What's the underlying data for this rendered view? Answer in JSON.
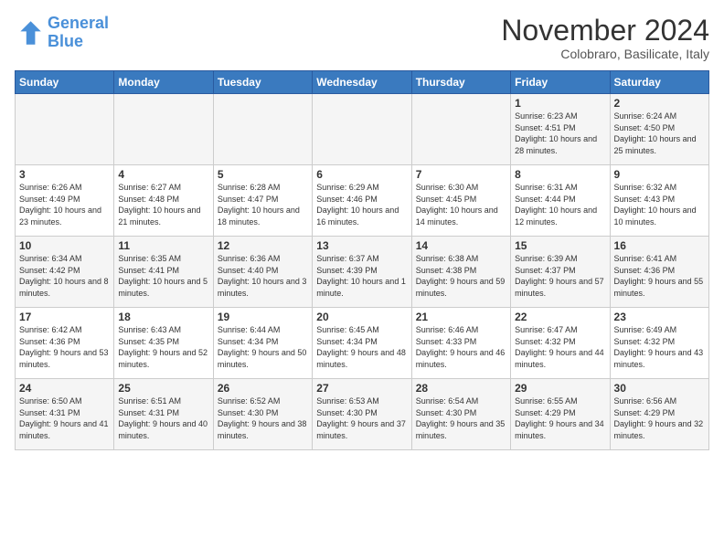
{
  "header": {
    "logo_line1": "General",
    "logo_line2": "Blue",
    "title": "November 2024",
    "subtitle": "Colobraro, Basilicate, Italy"
  },
  "columns": [
    "Sunday",
    "Monday",
    "Tuesday",
    "Wednesday",
    "Thursday",
    "Friday",
    "Saturday"
  ],
  "weeks": [
    [
      {
        "day": "",
        "info": ""
      },
      {
        "day": "",
        "info": ""
      },
      {
        "day": "",
        "info": ""
      },
      {
        "day": "",
        "info": ""
      },
      {
        "day": "",
        "info": ""
      },
      {
        "day": "1",
        "info": "Sunrise: 6:23 AM\nSunset: 4:51 PM\nDaylight: 10 hours\nand 28 minutes."
      },
      {
        "day": "2",
        "info": "Sunrise: 6:24 AM\nSunset: 4:50 PM\nDaylight: 10 hours\nand 25 minutes."
      }
    ],
    [
      {
        "day": "3",
        "info": "Sunrise: 6:26 AM\nSunset: 4:49 PM\nDaylight: 10 hours\nand 23 minutes."
      },
      {
        "day": "4",
        "info": "Sunrise: 6:27 AM\nSunset: 4:48 PM\nDaylight: 10 hours\nand 21 minutes."
      },
      {
        "day": "5",
        "info": "Sunrise: 6:28 AM\nSunset: 4:47 PM\nDaylight: 10 hours\nand 18 minutes."
      },
      {
        "day": "6",
        "info": "Sunrise: 6:29 AM\nSunset: 4:46 PM\nDaylight: 10 hours\nand 16 minutes."
      },
      {
        "day": "7",
        "info": "Sunrise: 6:30 AM\nSunset: 4:45 PM\nDaylight: 10 hours\nand 14 minutes."
      },
      {
        "day": "8",
        "info": "Sunrise: 6:31 AM\nSunset: 4:44 PM\nDaylight: 10 hours\nand 12 minutes."
      },
      {
        "day": "9",
        "info": "Sunrise: 6:32 AM\nSunset: 4:43 PM\nDaylight: 10 hours\nand 10 minutes."
      }
    ],
    [
      {
        "day": "10",
        "info": "Sunrise: 6:34 AM\nSunset: 4:42 PM\nDaylight: 10 hours\nand 8 minutes."
      },
      {
        "day": "11",
        "info": "Sunrise: 6:35 AM\nSunset: 4:41 PM\nDaylight: 10 hours\nand 5 minutes."
      },
      {
        "day": "12",
        "info": "Sunrise: 6:36 AM\nSunset: 4:40 PM\nDaylight: 10 hours\nand 3 minutes."
      },
      {
        "day": "13",
        "info": "Sunrise: 6:37 AM\nSunset: 4:39 PM\nDaylight: 10 hours\nand 1 minute."
      },
      {
        "day": "14",
        "info": "Sunrise: 6:38 AM\nSunset: 4:38 PM\nDaylight: 9 hours\nand 59 minutes."
      },
      {
        "day": "15",
        "info": "Sunrise: 6:39 AM\nSunset: 4:37 PM\nDaylight: 9 hours\nand 57 minutes."
      },
      {
        "day": "16",
        "info": "Sunrise: 6:41 AM\nSunset: 4:36 PM\nDaylight: 9 hours\nand 55 minutes."
      }
    ],
    [
      {
        "day": "17",
        "info": "Sunrise: 6:42 AM\nSunset: 4:36 PM\nDaylight: 9 hours\nand 53 minutes."
      },
      {
        "day": "18",
        "info": "Sunrise: 6:43 AM\nSunset: 4:35 PM\nDaylight: 9 hours\nand 52 minutes."
      },
      {
        "day": "19",
        "info": "Sunrise: 6:44 AM\nSunset: 4:34 PM\nDaylight: 9 hours\nand 50 minutes."
      },
      {
        "day": "20",
        "info": "Sunrise: 6:45 AM\nSunset: 4:34 PM\nDaylight: 9 hours\nand 48 minutes."
      },
      {
        "day": "21",
        "info": "Sunrise: 6:46 AM\nSunset: 4:33 PM\nDaylight: 9 hours\nand 46 minutes."
      },
      {
        "day": "22",
        "info": "Sunrise: 6:47 AM\nSunset: 4:32 PM\nDaylight: 9 hours\nand 44 minutes."
      },
      {
        "day": "23",
        "info": "Sunrise: 6:49 AM\nSunset: 4:32 PM\nDaylight: 9 hours\nand 43 minutes."
      }
    ],
    [
      {
        "day": "24",
        "info": "Sunrise: 6:50 AM\nSunset: 4:31 PM\nDaylight: 9 hours\nand 41 minutes."
      },
      {
        "day": "25",
        "info": "Sunrise: 6:51 AM\nSunset: 4:31 PM\nDaylight: 9 hours\nand 40 minutes."
      },
      {
        "day": "26",
        "info": "Sunrise: 6:52 AM\nSunset: 4:30 PM\nDaylight: 9 hours\nand 38 minutes."
      },
      {
        "day": "27",
        "info": "Sunrise: 6:53 AM\nSunset: 4:30 PM\nDaylight: 9 hours\nand 37 minutes."
      },
      {
        "day": "28",
        "info": "Sunrise: 6:54 AM\nSunset: 4:30 PM\nDaylight: 9 hours\nand 35 minutes."
      },
      {
        "day": "29",
        "info": "Sunrise: 6:55 AM\nSunset: 4:29 PM\nDaylight: 9 hours\nand 34 minutes."
      },
      {
        "day": "30",
        "info": "Sunrise: 6:56 AM\nSunset: 4:29 PM\nDaylight: 9 hours\nand 32 minutes."
      }
    ]
  ]
}
